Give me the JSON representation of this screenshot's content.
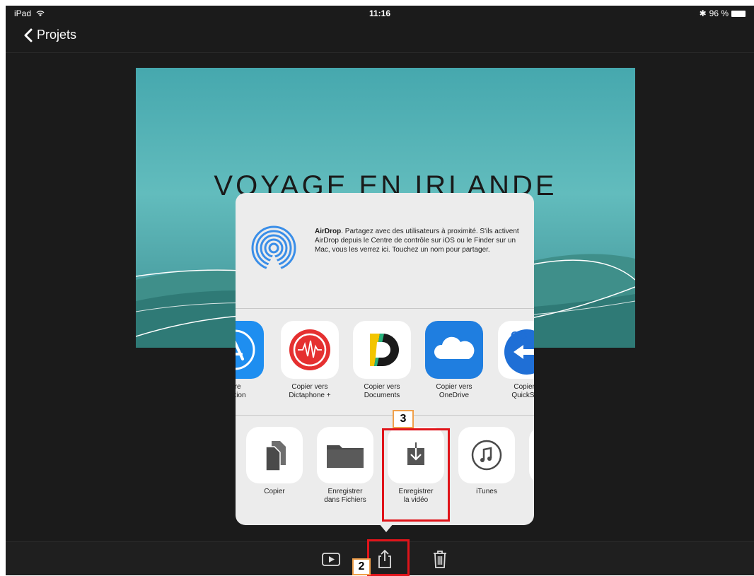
{
  "status_bar": {
    "device": "iPad",
    "time": "11:16",
    "battery": "96 %"
  },
  "nav": {
    "back_label": "Projets"
  },
  "preview": {
    "title": "VOYAGE EN IRLANDE"
  },
  "airdrop": {
    "title": "AirDrop",
    "description": ". Partagez avec des utilisateurs à proximité. S'ils activent AirDrop depuis le Centre de contrôle sur iOS ou le Finder sur un Mac, vous les verrez ici. Touchez un nom pour partager."
  },
  "apps": [
    {
      "label_line1": "utre",
      "label_line2": "lication",
      "icon": "app-store-icon"
    },
    {
      "label_line1": "Copier vers",
      "label_line2": "Dictaphone +",
      "icon": "dictaphone-icon"
    },
    {
      "label_line1": "Copier vers",
      "label_line2": "Documents",
      "icon": "documents-icon"
    },
    {
      "label_line1": "Copier vers",
      "label_line2": "OneDrive",
      "icon": "onedrive-icon"
    },
    {
      "label_line1": "Copier v",
      "label_line2": "QuickSup",
      "icon": "quicksupport-icon"
    }
  ],
  "actions": [
    {
      "label_line1": "Copier",
      "label_line2": "",
      "icon": "copy-icon"
    },
    {
      "label_line1": "Enregistrer",
      "label_line2": "dans Fichiers",
      "icon": "folder-icon"
    },
    {
      "label_line1": "Enregistrer",
      "label_line2": "la vidéo",
      "icon": "save-video-icon"
    },
    {
      "label_line1": "iTunes",
      "label_line2": "",
      "icon": "itunes-icon"
    }
  ],
  "annotations": {
    "step2": "2",
    "step3": "3"
  },
  "colors": {
    "highlight": "#e0141a",
    "label_border": "#f0a04b",
    "onedrive": "#1f7ee0",
    "dictaphone": "#e53030"
  }
}
